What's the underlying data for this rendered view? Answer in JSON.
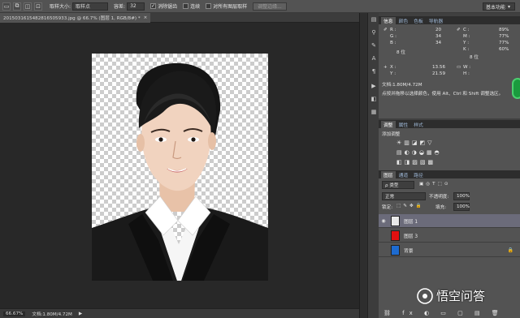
{
  "options_bar": {
    "sample_size_label": "取样大小:",
    "sample_size_value": "取样点",
    "tolerance_label": "容差:",
    "tolerance_value": "32",
    "antialias_label": "消除锯齿",
    "contiguous_label": "连续",
    "sample_all_label": "对所有图层取样",
    "refine_edge_label": "调整边缘...",
    "workspace_value": "基本功能"
  },
  "document": {
    "tab_title": "201503161548281650593​3.jpg @ 66.7% (图层 1, RGB/8#) *",
    "close": "×"
  },
  "status": {
    "zoom": "66.67%",
    "doc_size": "文档:1.80M/4.72M"
  },
  "info_panel": {
    "tabs": [
      "信息",
      "颜色",
      "色板",
      "导航器"
    ],
    "r_label": "R :",
    "r_value": "20",
    "g_label": "G :",
    "g_value": "34",
    "b_label": "B :",
    "b_value": "34",
    "c_label": "C :",
    "c_value": "89%",
    "m_label": "M :",
    "m_value": "77%",
    "y_label": "Y :",
    "y_value": "77%",
    "k_label": "K :",
    "k_value": "60%",
    "bit_left": "8 位",
    "bit_right": "8 位",
    "x_label": "X :",
    "x_value": "13.56",
    "y2_label": "Y :",
    "y2_value": "21.59",
    "w_label": "W :",
    "h_label": "H :",
    "doc_size": "文档:1.80M/4.72M",
    "hint": "点按并拖移以选择颜色，使用 Alt、Ctrl 和 Shift 调整选区。"
  },
  "adjust_panel": {
    "tabs": [
      "调整",
      "属性",
      "样式"
    ],
    "title": "添加调整"
  },
  "layers_panel": {
    "tabs": [
      "图层",
      "通道",
      "路径"
    ],
    "kind_label": "ρ 类型",
    "blend_mode": "正常",
    "opacity_label": "不透明度:",
    "opacity_value": "100%",
    "lock_label": "锁定:",
    "fill_label": "填充:",
    "fill_value": "100%",
    "layers": [
      {
        "name": "图层 1",
        "color": "#2a2a2a"
      },
      {
        "name": "图层 3",
        "color": "#e01010"
      },
      {
        "name": "背景",
        "color": "#1e6bd0"
      }
    ]
  },
  "watermark": {
    "text": "悟空问答"
  },
  "colors": {
    "bg": "#282828",
    "panel": "#535353",
    "accent": "#1a9b3e"
  }
}
